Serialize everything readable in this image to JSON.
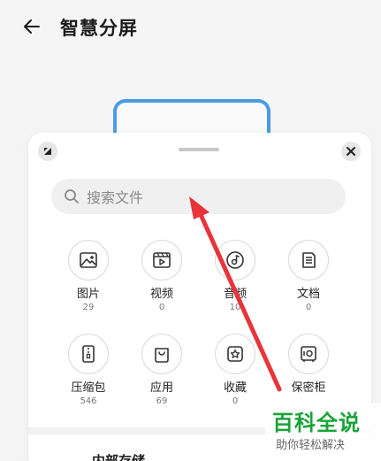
{
  "header": {
    "title": "智慧分屏"
  },
  "search": {
    "placeholder": "搜索文件"
  },
  "categories": [
    {
      "label": "图片",
      "count": "29",
      "icon": "image-icon"
    },
    {
      "label": "视频",
      "count": "0",
      "icon": "video-icon"
    },
    {
      "label": "音频",
      "count": "10",
      "icon": "audio-icon"
    },
    {
      "label": "文档",
      "count": "0",
      "icon": "document-icon"
    },
    {
      "label": "压缩包",
      "count": "546",
      "icon": "zip-icon"
    },
    {
      "label": "应用",
      "count": "69",
      "icon": "app-icon"
    },
    {
      "label": "收藏",
      "count": "0",
      "icon": "favorite-icon"
    },
    {
      "label": "保密柜",
      "count": "",
      "icon": "safe-icon"
    }
  ],
  "storage": {
    "label": "内部存储"
  },
  "watermark": {
    "main": "百科全说",
    "sub": "助你轻松解决"
  },
  "colors": {
    "accent": "#4a9be6",
    "arrow": "#e8343a",
    "watermark": "#1aa33a"
  }
}
